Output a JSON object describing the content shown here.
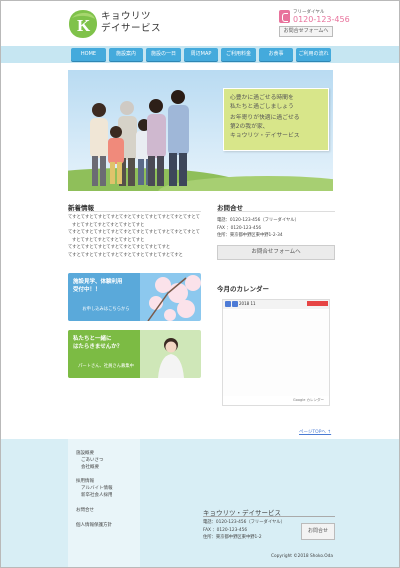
{
  "header": {
    "brand_line1": "キョウリツ",
    "brand_line2": "デイサービス",
    "logo_letter": "K",
    "tel_label": "フリーダイヤル",
    "tel_number": "0120-123-456",
    "contact_button": "お問合せフォームへ"
  },
  "nav": {
    "items": [
      {
        "label": "HOME"
      },
      {
        "label": "施設案内"
      },
      {
        "label": "施設の一日"
      },
      {
        "label": "周辺MAP"
      },
      {
        "label": "ご利用料金"
      },
      {
        "label": "お食事"
      },
      {
        "label": "ご利用の流れ"
      }
    ]
  },
  "hero": {
    "line1a": "心豊かに過ごせる時間を",
    "line1b": "私たちと過ごしましょう",
    "line2a": "お年寄りが快適に過ごせる",
    "line2b": "第2の我が家、",
    "line2c": "キョウリツ・デイサービス"
  },
  "news": {
    "title": "新着情報",
    "items": [
      "てすとてすとてすとてすとてすとてすとてすとてすとてすとてすとてすとてすとてすとてすとてすとてすと",
      "てすとてすとてすとてすとてすとてすとてすとてすとてすとてすとてすとてすとてすとてすとてすとてすと",
      "てすとてすとてすとてすとてすとてすとてすとてすと",
      "てすとてすとてすとてすとてすとてすとてすとてすとてすと"
    ]
  },
  "contact": {
    "title": "お問合せ",
    "line1": "電話：0120-123-456（フリーダイヤル）",
    "line2": "FAX ：0120-123-456",
    "line3": "住所：東京都中野区東中野1-2-34",
    "button": "お問合せフォームへ"
  },
  "banner_a": {
    "title1": "施設見学、体験利用",
    "title2": "受付中！！",
    "sub": "お申し込みはこちらから"
  },
  "banner_b": {
    "title1": "私たちと一緒に",
    "title2": "はたらきませんか？",
    "sub": "パートさん、社員さん募集中"
  },
  "calendar": {
    "title": "今月のカレンダー",
    "month": "2018 11",
    "google": "Google カレンダー"
  },
  "pagetop": "ページTOPへ ↑",
  "footer": {
    "nav": [
      {
        "label": "施設概要"
      },
      {
        "label": "ごあいさつ"
      },
      {
        "label": "会社概要"
      },
      {
        "label": "採用情報"
      },
      {
        "label": "アルバイト情報"
      },
      {
        "label": "新卒社会人採用"
      },
      {
        "label": "お問合せ"
      },
      {
        "label": "個人情報保護方針"
      }
    ],
    "company": "キョウリツ・デイサービス",
    "line1": "電話：0120-123-456（フリーダイヤル）",
    "line2": "FAX ：0120-123-456",
    "line3": "住所：東京都中野区東中野1-2",
    "button": "お問合せ",
    "copyright": "Copyright ©2018 Shoko.Oda"
  },
  "colors": {
    "nav_bg": "#c6e6f2",
    "nav_button": "#44aadc",
    "accent_pink": "#e8729c",
    "hero_note": "#d8e68a",
    "footer_bg": "#d8eef5"
  }
}
